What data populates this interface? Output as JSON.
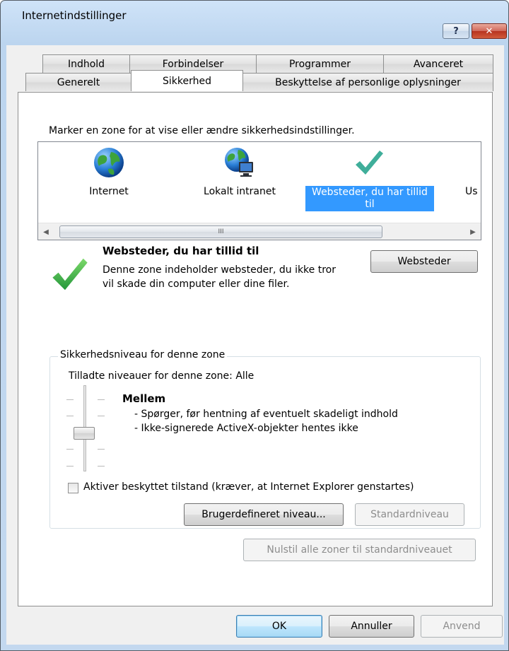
{
  "window": {
    "title": "Internetindstillinger",
    "help_label": "?",
    "close_label": "✕"
  },
  "tabs": {
    "row1": [
      "Indhold",
      "Forbindelser",
      "Programmer",
      "Avanceret"
    ],
    "row2": [
      "Generelt",
      "Sikkerhed",
      "Beskyttelse af personlige oplysninger"
    ],
    "active": "Sikkerhed"
  },
  "zones": {
    "instruction": "Marker en zone for at vise eller ændre sikkerhedsindstillinger.",
    "items": [
      {
        "label": "Internet",
        "icon": "globe-icon"
      },
      {
        "label": "Lokalt intranet",
        "icon": "intranet-globe-icon"
      },
      {
        "label": "Websteder, du har tillid til",
        "icon": "checkmark-icon",
        "selected": true
      },
      {
        "label": "Us",
        "icon": "restricted-icon"
      }
    ],
    "scroll_left": "◀",
    "scroll_right": "▶",
    "scroll_grip": "III"
  },
  "selected_zone": {
    "title": "Websteder, du har tillid til",
    "description_line1": "Denne zone indeholder websteder, du ikke tror",
    "description_line2": "vil skade din computer eller dine filer.",
    "sites_button": "Websteder"
  },
  "security_level": {
    "group_title": "Sikkerhedsniveau for denne zone",
    "allowed_levels": "Tilladte niveauer for denne zone: Alle",
    "level_name": "Mellem",
    "bullet1": "- Spørger, før hentning af eventuelt skadeligt indhold",
    "bullet2": "- Ikke-signerede ActiveX-objekter hentes ikke",
    "protected_mode_label": "Aktiver beskyttet tilstand (kræver, at Internet Explorer genstartes)",
    "protected_mode_checked": false,
    "custom_level_button": "Brugerdefineret niveau...",
    "default_level_button": "Standardniveau"
  },
  "reset_all_button": "Nulstil alle zoner til standardniveauet",
  "footer": {
    "ok": "OK",
    "cancel": "Annuller",
    "apply": "Anvend"
  },
  "colors": {
    "selection": "#3399ff",
    "checkmark": "#3fb84f"
  }
}
